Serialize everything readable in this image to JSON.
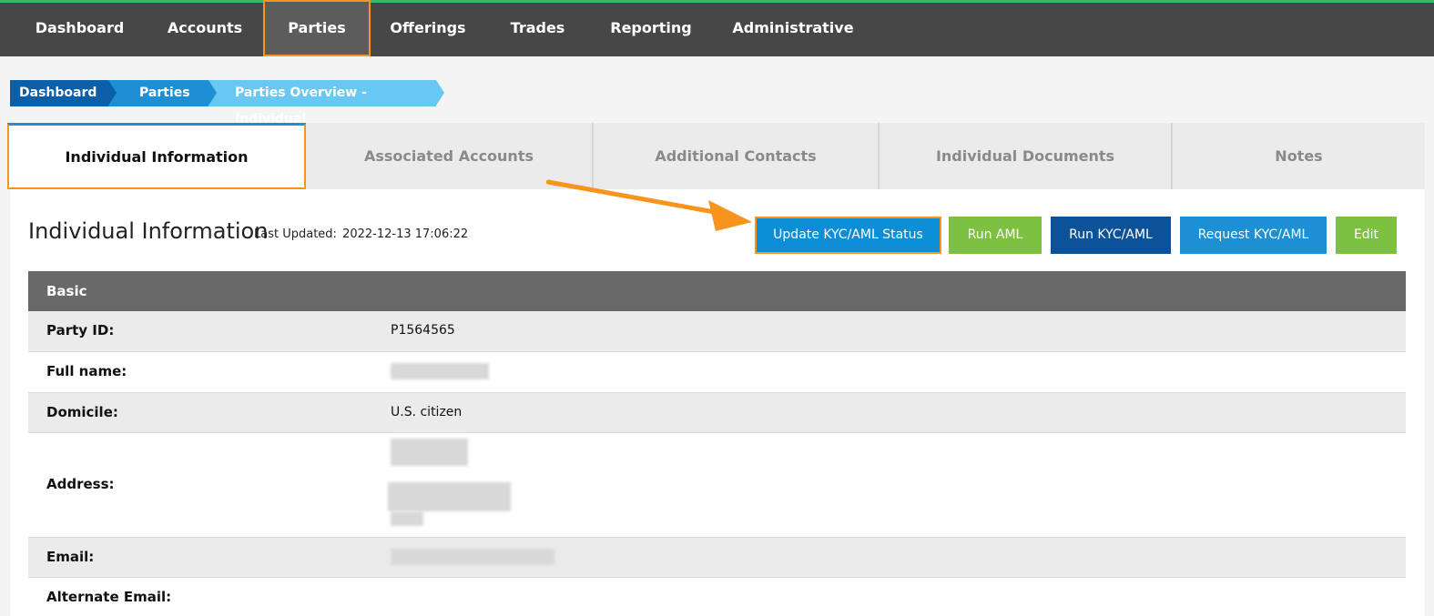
{
  "topnav": {
    "items": [
      "Dashboard",
      "Accounts",
      "Parties",
      "Offerings",
      "Trades",
      "Reporting",
      "Administrative"
    ],
    "active": "Parties"
  },
  "breadcrumb": [
    "Dashboard",
    "Parties",
    "Parties Overview - Individual"
  ],
  "tabs": [
    "Individual Information",
    "Associated Accounts",
    "Additional Contacts",
    "Individual Documents",
    "Notes"
  ],
  "section": {
    "title": "Individual Information",
    "last_updated_label": "Last Updated:",
    "last_updated_value": "2022-12-13 17:06:22"
  },
  "actions": {
    "update_kyc": "Update KYC/AML Status",
    "run_aml": "Run AML",
    "run_kyc": "Run KYC/AML",
    "request_kyc": "Request KYC/AML",
    "edit": "Edit"
  },
  "table": {
    "header": "Basic",
    "rows": [
      {
        "label": "Party ID:",
        "value": "P1564565"
      },
      {
        "label": "Full name:",
        "value": ""
      },
      {
        "label": "Domicile:",
        "value": "U.S. citizen"
      },
      {
        "label": "Address:",
        "value": ""
      },
      {
        "label": "Email:",
        "value": ""
      },
      {
        "label": "Alternate Email:",
        "value": ""
      }
    ]
  },
  "colors": {
    "nav_bg": "#474747",
    "highlight": "#f7941d",
    "blue_btn": "#0b8ed6",
    "green_btn": "#7cc142",
    "dark_blue_btn": "#0b5299"
  },
  "icons": [
    "annotation-arrow-icon"
  ]
}
